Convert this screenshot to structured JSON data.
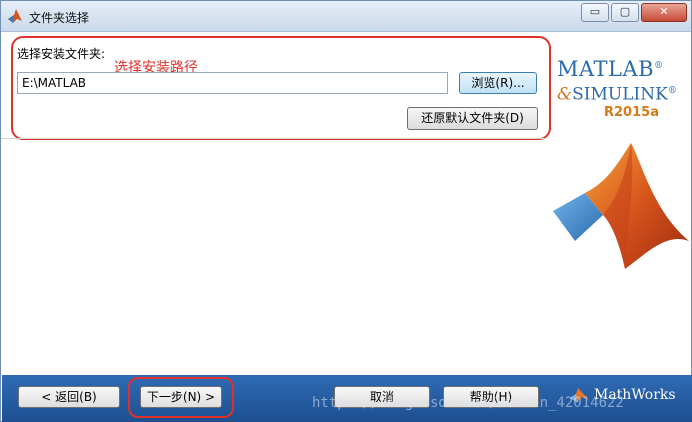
{
  "window": {
    "title": "文件夹选择",
    "minimize_symbol": "▭",
    "maximize_symbol": "▢",
    "close_symbol": "✕"
  },
  "folder": {
    "label": "选择安装文件夹:",
    "annotation": "选择安装路径",
    "path_value": "E:\\MATLAB",
    "browse_label": "浏览(R)...",
    "restore_label": "还原默认文件夹(D)"
  },
  "branding": {
    "line1": "MATLAB",
    "line2": "SIMULINK",
    "ampersand": "&",
    "reg_mark": "®",
    "version": "R2015a",
    "footer_logo": "MathWorks",
    "icons": [
      "matlab-membrane-logo",
      "mathworks-logo-icon",
      "matlab-title-icon"
    ]
  },
  "footer": {
    "back_label": "< 返回(B)",
    "next_label": "下一步(N) >",
    "cancel_label": "取消",
    "help_label": "帮助(H)",
    "watermark": "https://blog.csdn.net/weixin_42014622"
  },
  "colors": {
    "annotation_red": "#e0302a",
    "footer_blue": "#1d4f91",
    "logo_blue": "#2c6aa8",
    "version_orange": "#d57a18"
  }
}
